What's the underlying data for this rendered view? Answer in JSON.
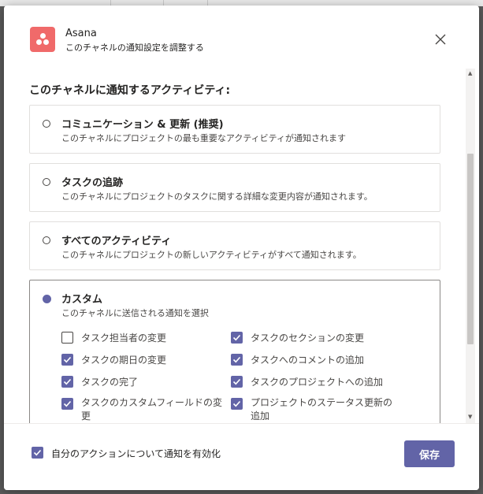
{
  "background": {
    "overlay_color": "#5a5a5a",
    "accent": "#6264a7",
    "logo_color": "#f06a6a"
  },
  "header": {
    "app_name": "Asana",
    "subtitle": "このチャネルの通知設定を調整する",
    "logo_icon": "asana-logo-icon",
    "close_icon": "close-icon"
  },
  "section_label": "このチャネルに通知するアクティビティ:",
  "options": [
    {
      "title": "コミュニケーション & 更新 (推奨)",
      "description": "このチャネルにプロジェクトの最も重要なアクティビティが通知されます",
      "selected": false
    },
    {
      "title": "タスクの追跡",
      "description": "このチャネルにプロジェクトのタスクに関する詳細な変更内容が通知されます。",
      "selected": false
    },
    {
      "title": "すべてのアクティビティ",
      "description": "このチャネルにプロジェクトの新しいアクティビティがすべて通知されます。",
      "selected": false
    },
    {
      "title": "カスタム",
      "description": "このチャネルに送信される通知を選択",
      "selected": true
    }
  ],
  "custom_checks": [
    {
      "label": "タスク担当者の変更",
      "checked": false
    },
    {
      "label": "タスクのセクションの変更",
      "checked": true
    },
    {
      "label": "タスクの期日の変更",
      "checked": true
    },
    {
      "label": "タスクへのコメントの追加",
      "checked": true
    },
    {
      "label": "タスクの完了",
      "checked": true
    },
    {
      "label": "タスクのプロジェクトへの追加",
      "checked": true
    },
    {
      "label": "タスクのカスタムフィールドの変更",
      "checked": true
    },
    {
      "label": "プロジェクトのステータス更新の追加",
      "checked": true
    }
  ],
  "footer": {
    "own_actions_label": "自分のアクションについて通知を有効化",
    "own_actions_checked": true,
    "save_label": "保存"
  }
}
